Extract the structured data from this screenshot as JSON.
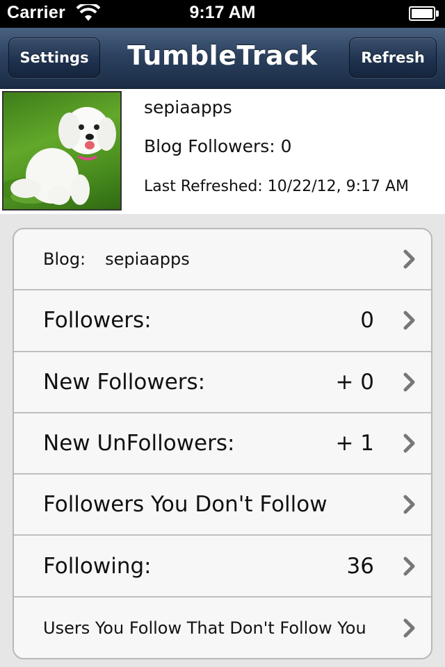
{
  "status_bar": {
    "carrier": "Carrier",
    "time": "9:17 AM"
  },
  "nav": {
    "title": "TumbleTrack",
    "left_button": "Settings",
    "right_button": "Refresh"
  },
  "profile": {
    "name": "sepiaapps",
    "followers": "Blog Followers: 0",
    "last_refreshed": "Last Refreshed: 10/22/12, 9:17 AM"
  },
  "rows": [
    {
      "label": "Blog:",
      "sub": "sepiaapps",
      "value": ""
    },
    {
      "label": "Followers:",
      "value": "0"
    },
    {
      "label": "New Followers:",
      "value": "+ 0"
    },
    {
      "label": "New UnFollowers:",
      "value": "+ 1"
    },
    {
      "label": "Followers You Don't Follow",
      "value": ""
    },
    {
      "label": "Following:",
      "value": "36"
    },
    {
      "label": "Users You Follow That Don't Follow You",
      "value": ""
    }
  ]
}
